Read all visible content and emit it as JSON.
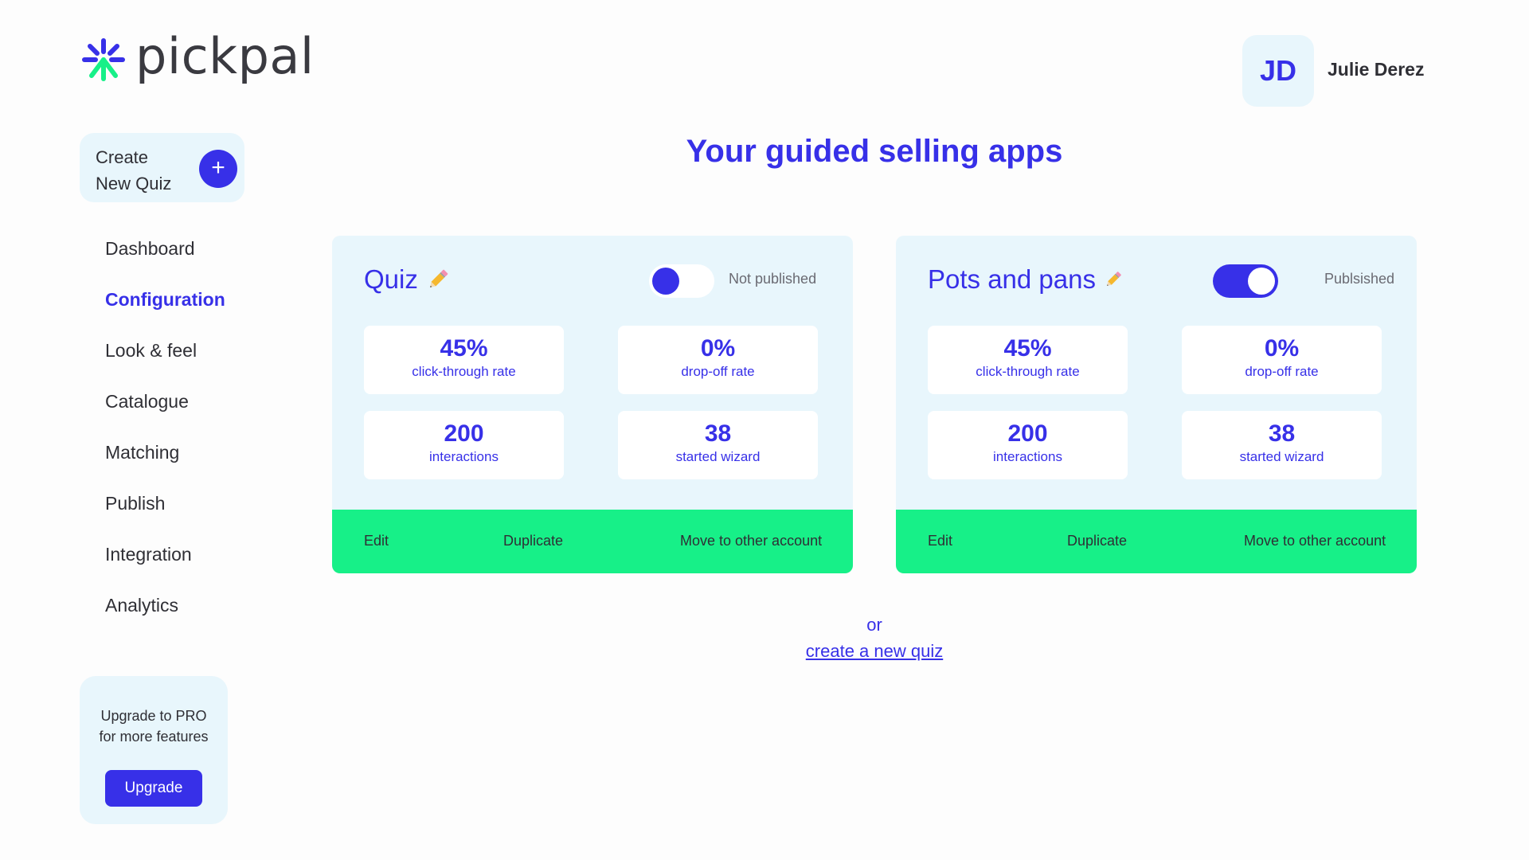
{
  "brand": {
    "name": "pickpal"
  },
  "user": {
    "initials": "JD",
    "name": "Julie Derez"
  },
  "create_quiz": {
    "line1": "Create",
    "line2": "New Quiz",
    "plus": "+"
  },
  "sidebar": {
    "items": [
      {
        "label": "Dashboard",
        "active": false
      },
      {
        "label": "Configuration",
        "active": true
      },
      {
        "label": "Look & feel",
        "active": false
      },
      {
        "label": "Catalogue",
        "active": false
      },
      {
        "label": "Matching",
        "active": false
      },
      {
        "label": "Publish",
        "active": false
      },
      {
        "label": "Integration",
        "active": false
      },
      {
        "label": "Analytics",
        "active": false
      }
    ]
  },
  "upgrade": {
    "line1": "Upgrade to PRO",
    "line2": "for more features",
    "button": "Upgrade"
  },
  "main": {
    "title": "Your guided selling apps",
    "apps": [
      {
        "name": "Quiz",
        "published": false,
        "status": "Not published",
        "stats": [
          {
            "value": "45%",
            "label": "click-through rate"
          },
          {
            "value": "0%",
            "label": "drop-off rate"
          },
          {
            "value": "200",
            "label": "interactions"
          },
          {
            "value": "38",
            "label": "started wizard"
          }
        ],
        "actions": {
          "edit": "Edit",
          "duplicate": "Duplicate",
          "move": "Move to other account"
        }
      },
      {
        "name": "Pots and pans",
        "published": true,
        "status": "Publsished",
        "stats": [
          {
            "value": "45%",
            "label": "click-through rate"
          },
          {
            "value": "0%",
            "label": "drop-off rate"
          },
          {
            "value": "200",
            "label": "interactions"
          },
          {
            "value": "38",
            "label": "started wizard"
          }
        ],
        "actions": {
          "edit": "Edit",
          "duplicate": "Duplicate",
          "move": "Move to other account"
        }
      }
    ],
    "or_text": "or",
    "create_link": "create a new quiz"
  },
  "colors": {
    "accent": "#3730e8",
    "green": "#17f088",
    "card_bg": "#e8f6fc"
  },
  "icons": {
    "logo": "spark-arrow-icon",
    "edit": "pencil-icon",
    "add": "plus-icon"
  }
}
